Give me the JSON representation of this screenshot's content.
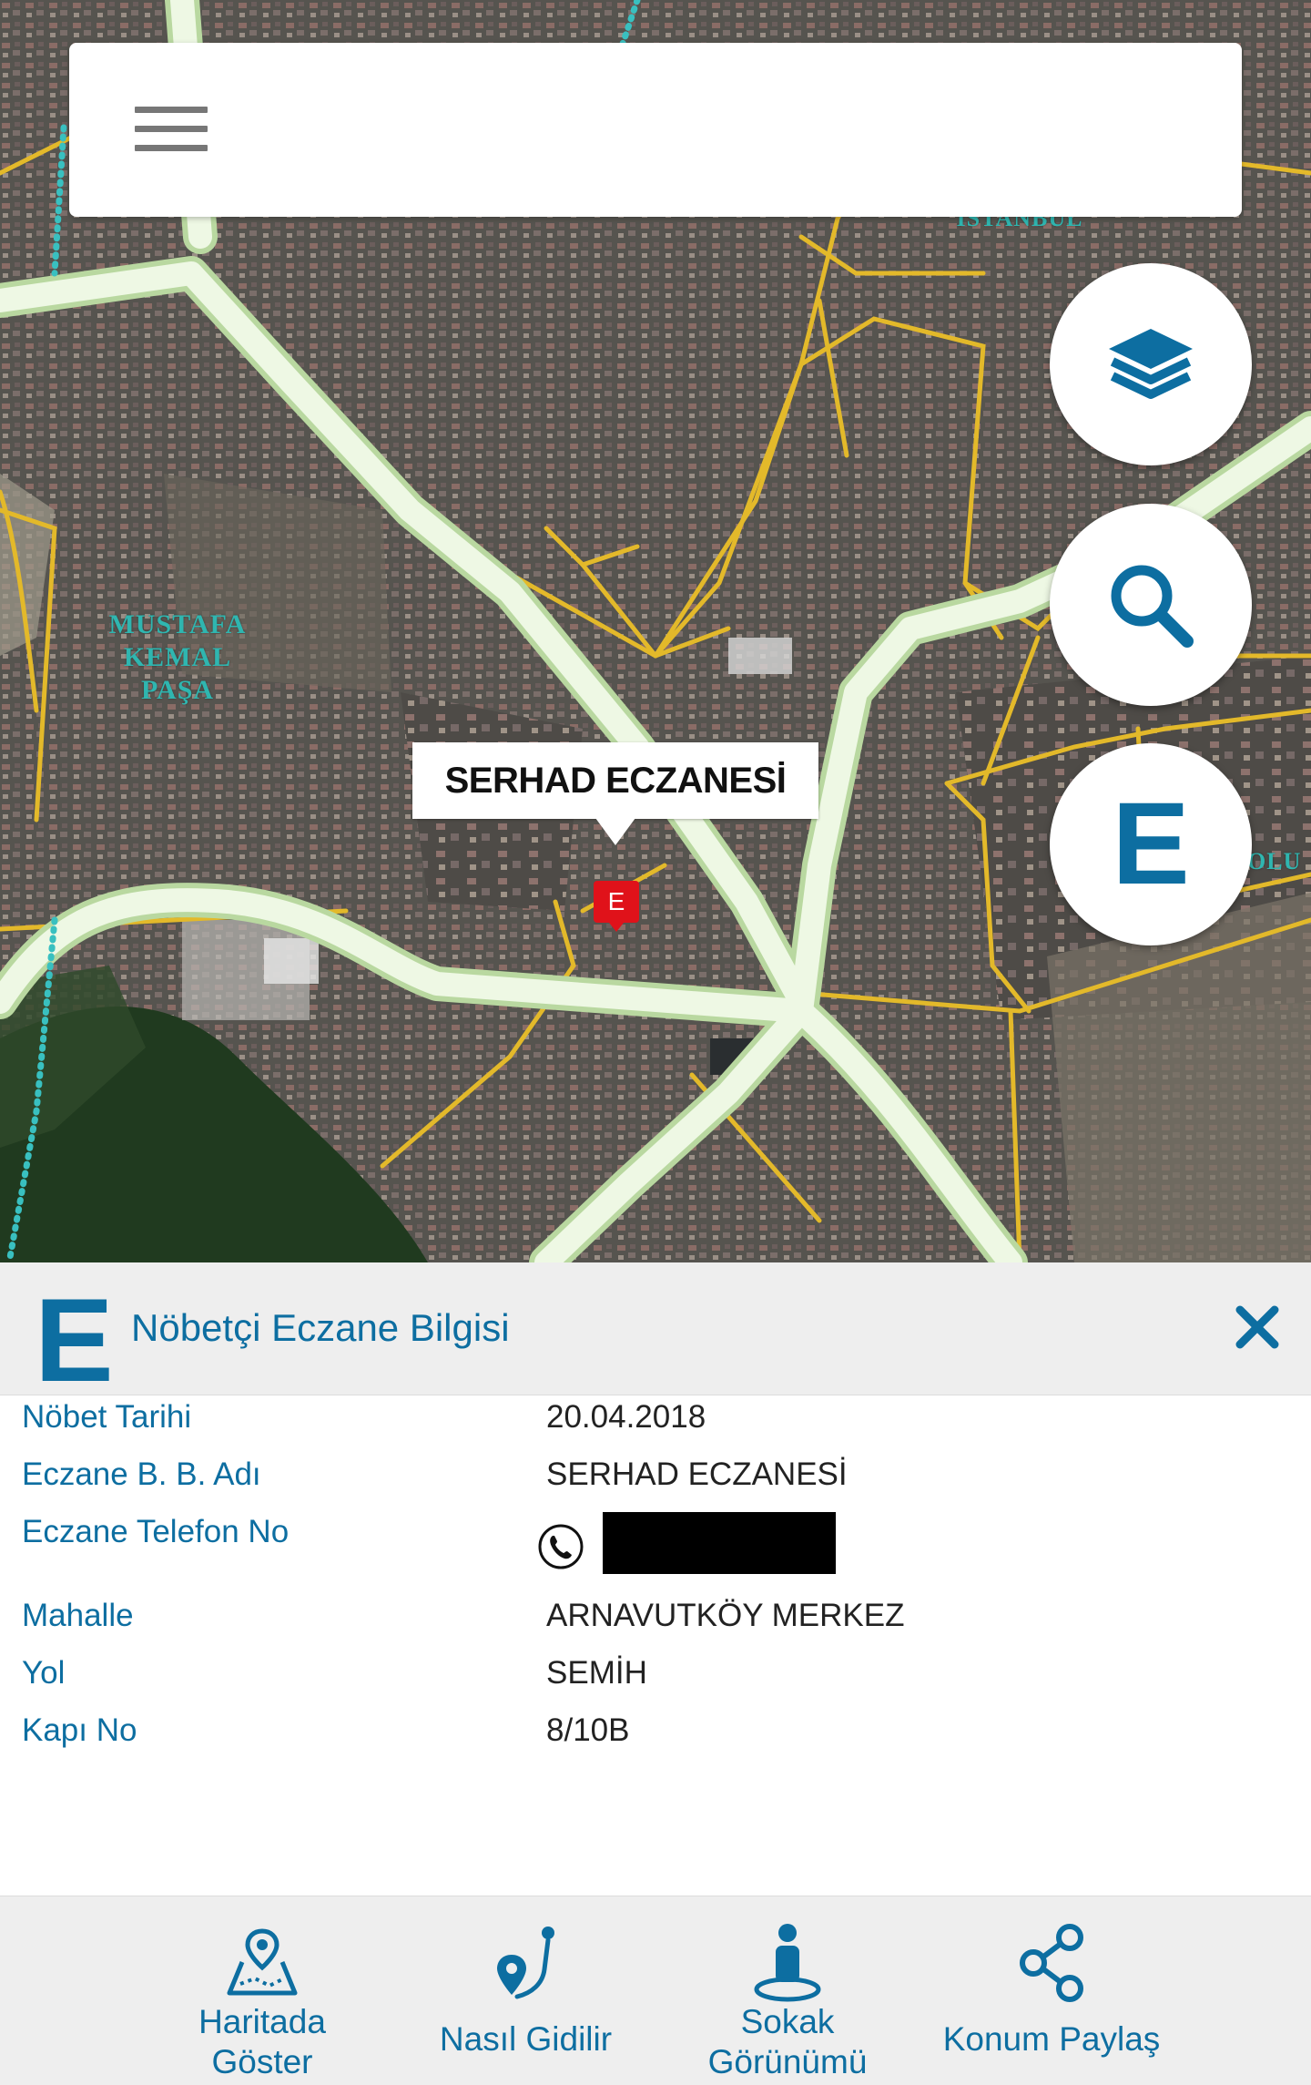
{
  "map": {
    "labels": {
      "mustafa": "MUSTAFA\nKEMAL\nPAŞA",
      "istanbul": "İSTANBUL",
      "edge_right": "OLU"
    },
    "marker": {
      "callout_text": "SERHAD ECZANESİ",
      "pin_letter": "E"
    },
    "fabs": {
      "layers_icon": "layers-icon",
      "search_icon": "search-icon",
      "pharmacy_letter": "E"
    },
    "colors": {
      "accent": "#0d6ea1",
      "pin": "#e0121a",
      "main_road": "#e7f4d8",
      "minor_road": "#e3b92a"
    }
  },
  "panel": {
    "logo_letter": "E",
    "title": "Nöbetçi Eczane Bilgisi",
    "close_icon": "close-icon",
    "rows": [
      {
        "label": "Nöbet Tarihi",
        "value": "20.04.2018"
      },
      {
        "label": "Eczane B. B. Adı",
        "value": "SERHAD ECZANESİ"
      },
      {
        "label": "Eczane Telefon No",
        "value": ""
      },
      {
        "label": "Mahalle",
        "value": "ARNAVUTKÖY MERKEZ"
      },
      {
        "label": "Yol",
        "value": "SEMİH"
      },
      {
        "label": "Kapı No",
        "value": "8/10B"
      }
    ]
  },
  "bottom_nav": {
    "items": [
      {
        "label": "Haritada\nGöster",
        "icon": "map-pin-icon"
      },
      {
        "label": "Nasıl Gidilir",
        "icon": "route-icon"
      },
      {
        "label": "Sokak\nGörünümü",
        "icon": "street-view-icon"
      },
      {
        "label": "Konum Paylaş",
        "icon": "share-icon"
      }
    ]
  }
}
